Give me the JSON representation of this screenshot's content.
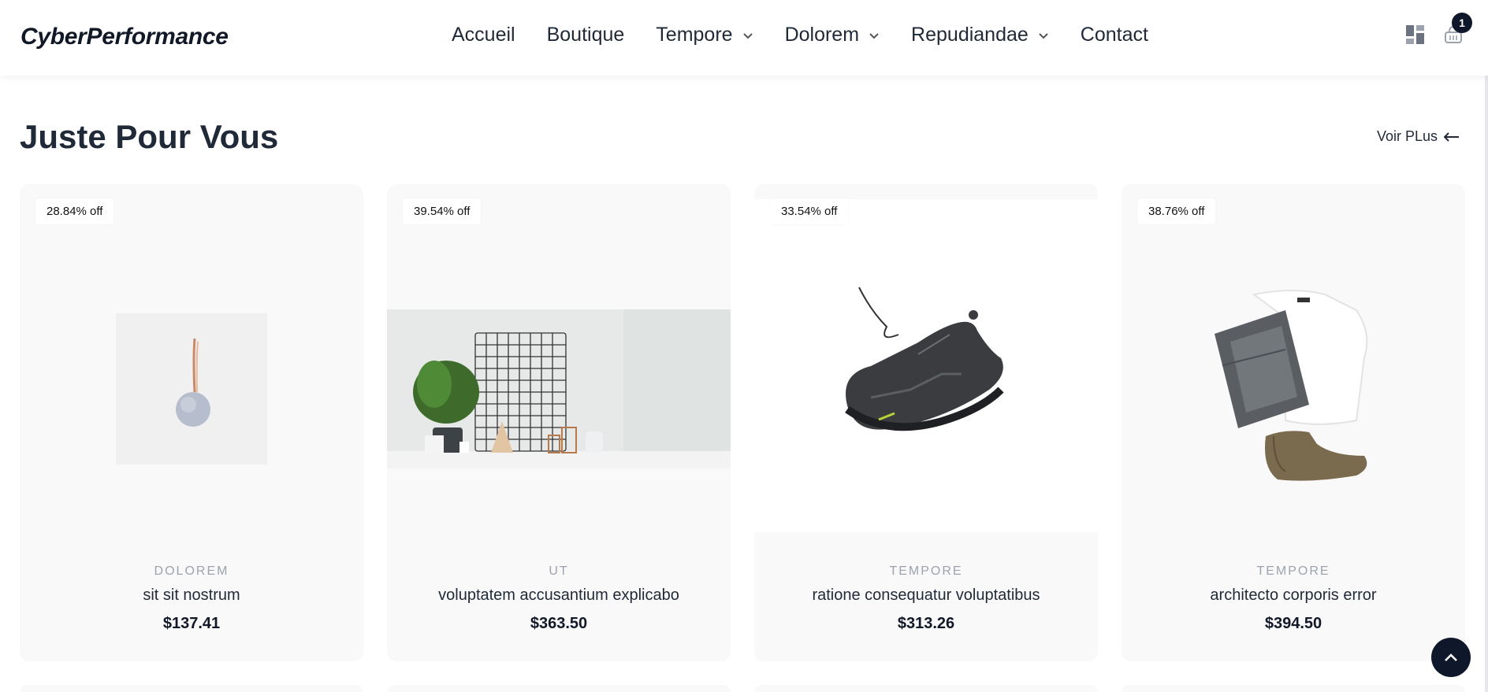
{
  "brand": "CyberPerformance",
  "nav": [
    {
      "label": "Accueil",
      "dropdown": false
    },
    {
      "label": "Boutique",
      "dropdown": false
    },
    {
      "label": "Tempore",
      "dropdown": true
    },
    {
      "label": "Dolorem",
      "dropdown": true
    },
    {
      "label": "Repudiandae",
      "dropdown": true
    },
    {
      "label": "Contact",
      "dropdown": false
    }
  ],
  "header_icons": {
    "layout_icon": "grid-layout-icon",
    "cart_icon": "basket-icon",
    "cart_count": "1"
  },
  "section": {
    "title": "Juste Pour Vous",
    "see_more": "Voir PLus"
  },
  "products": [
    {
      "discount": "28.84% off",
      "category": "DOLOREM",
      "name": "sit sit nostrum",
      "price": "$137.41",
      "image": "hanging-speaker"
    },
    {
      "discount": "39.54% off",
      "category": "UT",
      "name": "voluptatem accusantium explicabo",
      "price": "$363.50",
      "image": "shelf-decor"
    },
    {
      "discount": "33.54% off",
      "category": "TEMPORE",
      "name": "ratione consequatur voluptatibus",
      "price": "$313.26",
      "image": "sneaker"
    },
    {
      "discount": "38.76% off",
      "category": "TEMPORE",
      "name": "architecto corporis error",
      "price": "$394.50",
      "image": "outfit"
    }
  ],
  "colors": {
    "dark": "#0f172a",
    "card_bg": "#f9f9f9",
    "muted": "#9ca3af"
  }
}
